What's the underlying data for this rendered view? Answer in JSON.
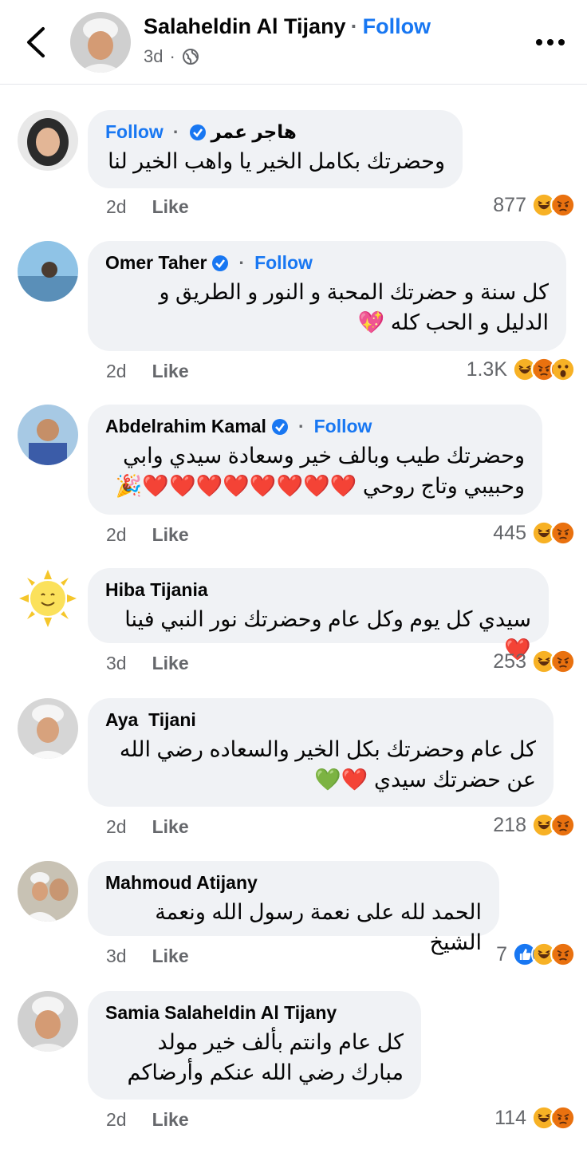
{
  "header": {
    "name": "Salaheldin Al Tijany",
    "separator": "·",
    "follow": "Follow",
    "time": "3d",
    "sub_sep": "·"
  },
  "like_label": "Like",
  "comments": [
    {
      "author": "هاجر عمر",
      "verified": true,
      "follow": "Follow",
      "text": "وحضرتك بكامل الخير يا واهب الخير لنا",
      "time": "2d",
      "count": "877"
    },
    {
      "author": "Omer Taher",
      "verified": true,
      "follow": "Follow",
      "text": "كل سنة و حضرتك المحبة و النور و الطريق و الدليل و الحب كله 💖",
      "time": "2d",
      "count": "1.3K"
    },
    {
      "author": "Abdelrahim Kamal",
      "verified": true,
      "follow": "Follow",
      "text": "وحضرتك طيب وبالف خير وسعادة سيدي وابي وحبيبي وتاج روحي ❤️❤️❤️❤️❤️❤️❤️❤️🎉",
      "time": "2d",
      "count": "445"
    },
    {
      "author": "Hiba Tijania",
      "verified": false,
      "follow": "",
      "text": "سيدي كل يوم وكل عام وحضرتك نور النبي فينا❤️",
      "time": "3d",
      "count": "253"
    },
    {
      "author": "Aya  Tijani",
      "verified": false,
      "follow": "",
      "text": "كل عام وحضرتك بكل الخير والسعاده رضي الله عن حضرتك سيدي ❤️💚",
      "time": "2d",
      "count": "218"
    },
    {
      "author": "Mahmoud Atijany",
      "verified": false,
      "follow": "",
      "text": "الحمد لله على نعمة رسول الله ونعمة الشيخ",
      "time": "3d",
      "count": "7"
    },
    {
      "author": "Samia Salaheldin Al Tijany",
      "verified": false,
      "follow": "",
      "text": "كل عام وانتم بألف خير مولد مبارك رضي الله عنكم وأرضاكم",
      "time": "2d",
      "count": "114"
    }
  ],
  "colors": {
    "accent": "#1877f2",
    "bubble": "#f0f2f5",
    "secondary": "#65676b",
    "haha": "#f7b125",
    "angry": "#e9710f",
    "like": "#1877f2"
  }
}
